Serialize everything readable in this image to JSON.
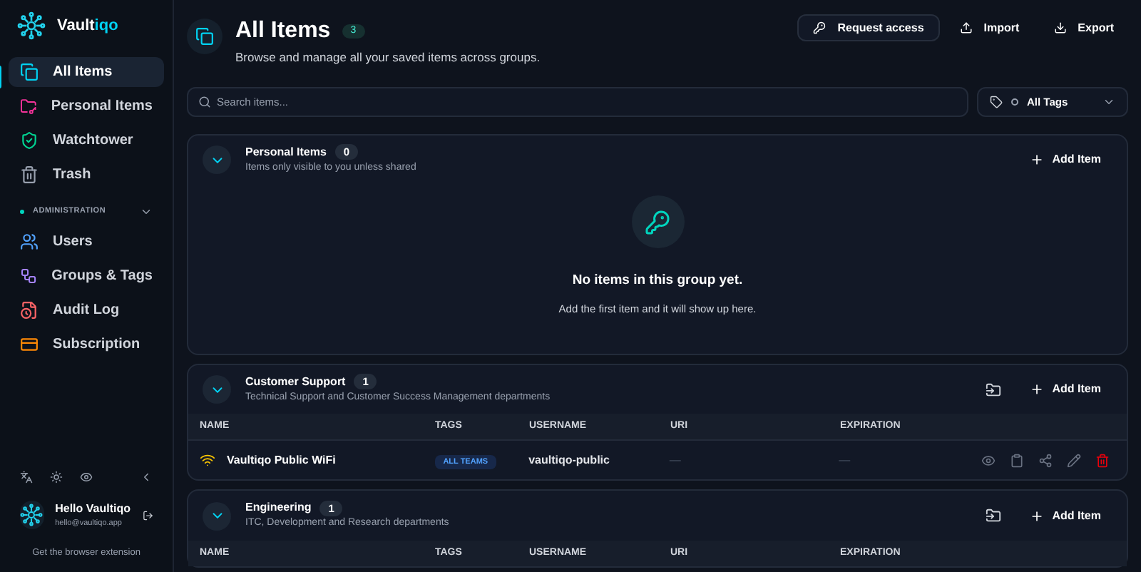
{
  "brand": {
    "name": "Vault",
    "accent": "iqo"
  },
  "nav": [
    {
      "label": "All Items",
      "selected": true
    },
    {
      "label": "Personal Items",
      "selected": false
    },
    {
      "label": "Watchtower",
      "selected": false
    },
    {
      "label": "Trash",
      "selected": false
    }
  ],
  "admin": {
    "title": "ADMINISTRATION",
    "expanded": true,
    "items": [
      {
        "label": "Users",
        "selected": false
      },
      {
        "label": "Groups & Tags",
        "selected": false
      },
      {
        "label": "Audit Log",
        "selected": false
      },
      {
        "label": "Subscription",
        "selected": false
      }
    ]
  },
  "user": {
    "name": "Hello Vaultiqo",
    "email": "hello@vaultiqo.app"
  },
  "extension_link": "Get the browser extension",
  "header": {
    "title": "All Items",
    "count": "3",
    "subtitle": "Browse and manage all your saved items across groups.",
    "actions": [
      "Request access",
      "Import",
      "Export"
    ]
  },
  "search": {
    "placeholder": "Search items..."
  },
  "tag_filter": {
    "value": "All Tags"
  },
  "groups": [
    {
      "name": "Personal Items",
      "count": "0",
      "description": "Items only visible to you unless shared",
      "expanded": true,
      "add_label": "Add Item",
      "empty": {
        "title": "No items in this group yet.",
        "text": "Add the first item and it will show up here."
      }
    },
    {
      "name": "Customer Support",
      "count": "1",
      "description": "Technical Support and Customer Success Management departments",
      "expanded": true,
      "add_label": "Add Item",
      "columns": [
        "NAME",
        "TAGS",
        "USERNAME",
        "URI",
        "EXPIRATION"
      ],
      "rows": [
        {
          "name": "Vaultiqo Public WiFi",
          "tag": "ALL TEAMS",
          "username": "vaultiqo-public",
          "uri": "—",
          "expiration": "—"
        }
      ]
    },
    {
      "name": "Engineering",
      "count": "1",
      "description": "ITC, Development and Research departments",
      "expanded": true,
      "add_label": "Add Item",
      "columns": [
        "NAME",
        "TAGS",
        "USERNAME",
        "URI",
        "EXPIRATION"
      ]
    }
  ]
}
